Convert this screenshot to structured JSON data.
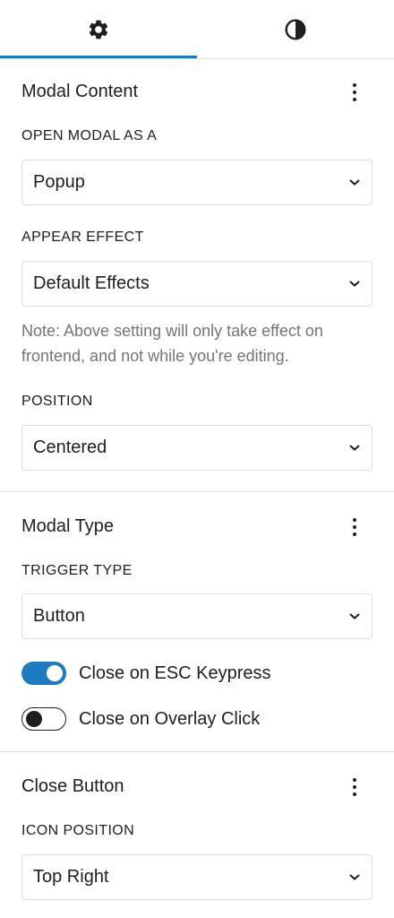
{
  "tabs": {
    "settings_icon": "gear-icon",
    "styles_icon": "half-circle-contrast-icon",
    "active": "settings",
    "accent_color": "#1e7bbf"
  },
  "modal_content": {
    "title": "Modal Content",
    "open_modal_as": {
      "label": "OPEN MODAL AS A",
      "value": "Popup"
    },
    "appear_effect": {
      "label": "APPEAR EFFECT",
      "value": "Default Effects"
    },
    "note": "Note: Above setting will only take effect on frontend, and not while you're editing.",
    "position": {
      "label": "POSITION",
      "value": "Centered"
    }
  },
  "modal_type": {
    "title": "Modal Type",
    "trigger_type": {
      "label": "TRIGGER TYPE",
      "value": "Button"
    },
    "close_on_esc": {
      "label": "Close on ESC Keypress",
      "checked": true
    },
    "close_on_overlay": {
      "label": "Close on Overlay Click",
      "checked": false
    }
  },
  "close_button": {
    "title": "Close Button",
    "icon_position": {
      "label": "ICON POSITION",
      "value": "Top Right"
    }
  }
}
